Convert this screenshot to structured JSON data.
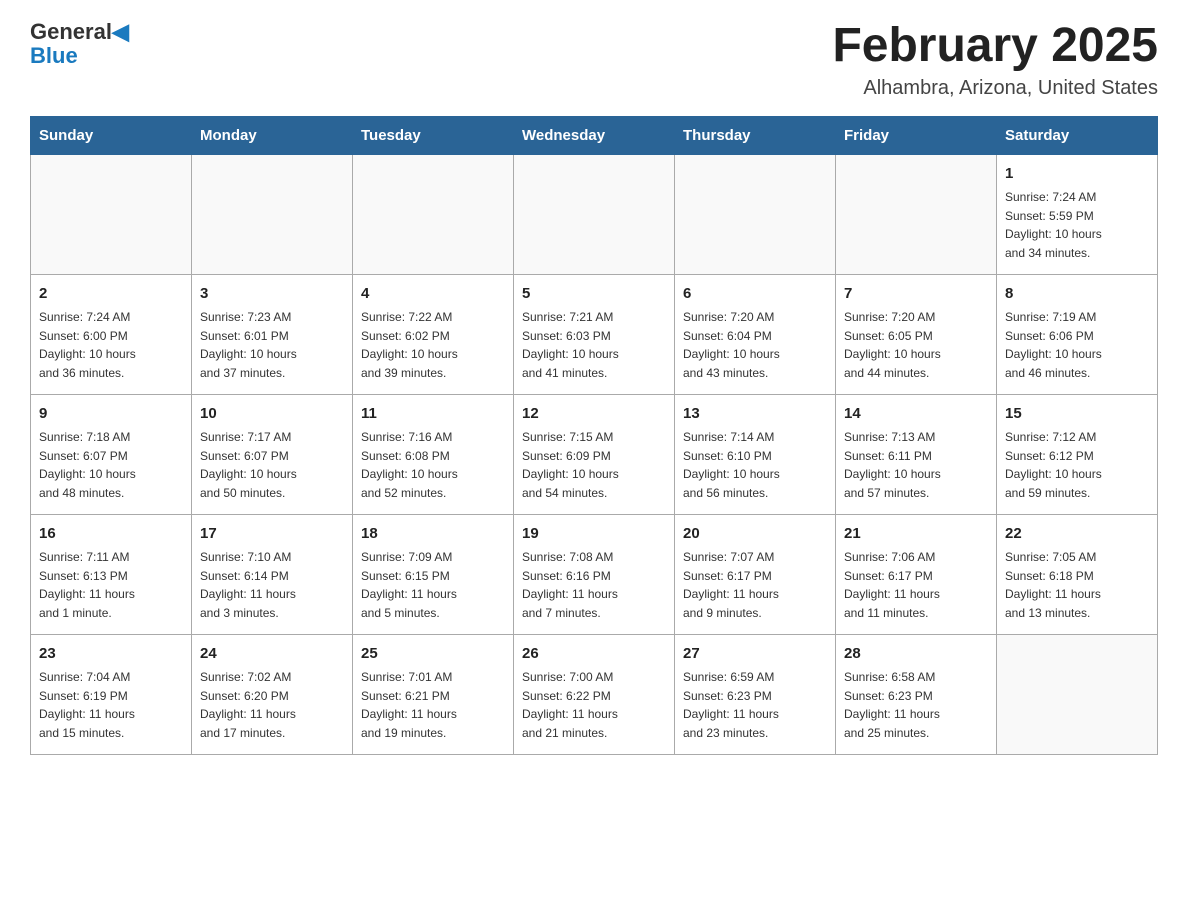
{
  "header": {
    "logo_general": "General",
    "logo_blue": "Blue",
    "month_title": "February 2025",
    "location": "Alhambra, Arizona, United States"
  },
  "days_of_week": [
    "Sunday",
    "Monday",
    "Tuesday",
    "Wednesday",
    "Thursday",
    "Friday",
    "Saturday"
  ],
  "weeks": [
    [
      {
        "day": "",
        "info": ""
      },
      {
        "day": "",
        "info": ""
      },
      {
        "day": "",
        "info": ""
      },
      {
        "day": "",
        "info": ""
      },
      {
        "day": "",
        "info": ""
      },
      {
        "day": "",
        "info": ""
      },
      {
        "day": "1",
        "info": "Sunrise: 7:24 AM\nSunset: 5:59 PM\nDaylight: 10 hours\nand 34 minutes."
      }
    ],
    [
      {
        "day": "2",
        "info": "Sunrise: 7:24 AM\nSunset: 6:00 PM\nDaylight: 10 hours\nand 36 minutes."
      },
      {
        "day": "3",
        "info": "Sunrise: 7:23 AM\nSunset: 6:01 PM\nDaylight: 10 hours\nand 37 minutes."
      },
      {
        "day": "4",
        "info": "Sunrise: 7:22 AM\nSunset: 6:02 PM\nDaylight: 10 hours\nand 39 minutes."
      },
      {
        "day": "5",
        "info": "Sunrise: 7:21 AM\nSunset: 6:03 PM\nDaylight: 10 hours\nand 41 minutes."
      },
      {
        "day": "6",
        "info": "Sunrise: 7:20 AM\nSunset: 6:04 PM\nDaylight: 10 hours\nand 43 minutes."
      },
      {
        "day": "7",
        "info": "Sunrise: 7:20 AM\nSunset: 6:05 PM\nDaylight: 10 hours\nand 44 minutes."
      },
      {
        "day": "8",
        "info": "Sunrise: 7:19 AM\nSunset: 6:06 PM\nDaylight: 10 hours\nand 46 minutes."
      }
    ],
    [
      {
        "day": "9",
        "info": "Sunrise: 7:18 AM\nSunset: 6:07 PM\nDaylight: 10 hours\nand 48 minutes."
      },
      {
        "day": "10",
        "info": "Sunrise: 7:17 AM\nSunset: 6:07 PM\nDaylight: 10 hours\nand 50 minutes."
      },
      {
        "day": "11",
        "info": "Sunrise: 7:16 AM\nSunset: 6:08 PM\nDaylight: 10 hours\nand 52 minutes."
      },
      {
        "day": "12",
        "info": "Sunrise: 7:15 AM\nSunset: 6:09 PM\nDaylight: 10 hours\nand 54 minutes."
      },
      {
        "day": "13",
        "info": "Sunrise: 7:14 AM\nSunset: 6:10 PM\nDaylight: 10 hours\nand 56 minutes."
      },
      {
        "day": "14",
        "info": "Sunrise: 7:13 AM\nSunset: 6:11 PM\nDaylight: 10 hours\nand 57 minutes."
      },
      {
        "day": "15",
        "info": "Sunrise: 7:12 AM\nSunset: 6:12 PM\nDaylight: 10 hours\nand 59 minutes."
      }
    ],
    [
      {
        "day": "16",
        "info": "Sunrise: 7:11 AM\nSunset: 6:13 PM\nDaylight: 11 hours\nand 1 minute."
      },
      {
        "day": "17",
        "info": "Sunrise: 7:10 AM\nSunset: 6:14 PM\nDaylight: 11 hours\nand 3 minutes."
      },
      {
        "day": "18",
        "info": "Sunrise: 7:09 AM\nSunset: 6:15 PM\nDaylight: 11 hours\nand 5 minutes."
      },
      {
        "day": "19",
        "info": "Sunrise: 7:08 AM\nSunset: 6:16 PM\nDaylight: 11 hours\nand 7 minutes."
      },
      {
        "day": "20",
        "info": "Sunrise: 7:07 AM\nSunset: 6:17 PM\nDaylight: 11 hours\nand 9 minutes."
      },
      {
        "day": "21",
        "info": "Sunrise: 7:06 AM\nSunset: 6:17 PM\nDaylight: 11 hours\nand 11 minutes."
      },
      {
        "day": "22",
        "info": "Sunrise: 7:05 AM\nSunset: 6:18 PM\nDaylight: 11 hours\nand 13 minutes."
      }
    ],
    [
      {
        "day": "23",
        "info": "Sunrise: 7:04 AM\nSunset: 6:19 PM\nDaylight: 11 hours\nand 15 minutes."
      },
      {
        "day": "24",
        "info": "Sunrise: 7:02 AM\nSunset: 6:20 PM\nDaylight: 11 hours\nand 17 minutes."
      },
      {
        "day": "25",
        "info": "Sunrise: 7:01 AM\nSunset: 6:21 PM\nDaylight: 11 hours\nand 19 minutes."
      },
      {
        "day": "26",
        "info": "Sunrise: 7:00 AM\nSunset: 6:22 PM\nDaylight: 11 hours\nand 21 minutes."
      },
      {
        "day": "27",
        "info": "Sunrise: 6:59 AM\nSunset: 6:23 PM\nDaylight: 11 hours\nand 23 minutes."
      },
      {
        "day": "28",
        "info": "Sunrise: 6:58 AM\nSunset: 6:23 PM\nDaylight: 11 hours\nand 25 minutes."
      },
      {
        "day": "",
        "info": ""
      }
    ]
  ]
}
